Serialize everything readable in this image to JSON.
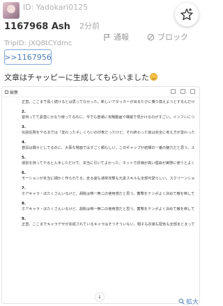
{
  "header": {
    "user_id": "ID: Yadokari0125"
  },
  "post": {
    "number": "1167968 Ash",
    "time": "2分前",
    "trip": "TripID: jXQ8tCYdmc",
    "report_label": "通報",
    "block_label": "ブロック",
    "reply_label": ">>1167956",
    "message": "文章はチャッピーに生成してもらいました"
  },
  "document": {
    "title": "編集",
    "items": [
      {
        "num": "",
        "lines": [
          "正直、ここまで長く続けるとは思ってなかった。新しいアタッカーが出るたびに乗り換えようとするんだけど、結局前線の操作感が一番しっくりくる。性能だけじゃなくて、キャラとして愛着が湧くんだよね。"
        ]
      },
      {
        "num": "2.",
        "lines": [
          "昔持ってて素直にかなり使ってるのに、今でも普通に攻略動画や構築で見かけるのがすごい。インフレについていけなくなるキャラも多い中で、ちゃんと活躍できるのは完成度が高い証拠だと思う。"
        ]
      },
      {
        "num": "3.",
        "lines": [
          "伝説任務をやるまでは「変わった子」くらいの印象だったけど、それ終わった後は完全に考え方が変わった。命や別れに対する考え方がすごくしっかりしていて、見た目とのギャップに驚かれた。"
        ]
      },
      {
        "num": "4.",
        "lines": [
          "普段は飄々としてるのに、大事な場面ではすごく頼もしい。このギャップが結構の一番の魅力だと思う。スチキャラ以上に見えて単なるだけではない。"
        ]
      },
      {
        "num": "5.",
        "lines": [
          "運別を持ってやると入手しただけで、本当に引いてよかった。ネットで評価が高い理由が実際に使うとよく分かる。ここまで満足度が高いキャラはそう多くない。"
        ]
      },
      {
        "num": "6.",
        "lines": [
          "モーションが本当に細かく作られてる。走る姿も通常攻撃も元素スキルも全部可愛らしい。スクリーンショットを撮る手が止まらない。見ていて飽きないキャラ。"
        ]
      },
      {
        "num": "7.",
        "lines": [
          "ホアキャラ・ほたくさんいるけど、胡桃は唯一無二の使用感だと思う。蓄撃をテンポよく決めて敵を倒していく感覚が本当に気持ちいい。"
        ]
      },
      {
        "num": "8.",
        "lines": [
          "ホアキャラ・ほたくさんいるけど、胡桃は唯一無二の使用感だと思う。蓄撃をテンポよく決めて敵を倒していく感覚が本当に気持ちいい。"
        ]
      },
      {
        "num": "9.",
        "lines": [
          "正直、ここまでキャラデザが完成されているキャラはそうそういない。帽子も衣装も配色も全部まとまって"
        ]
      }
    ]
  },
  "enlarge_label": "拡大"
}
